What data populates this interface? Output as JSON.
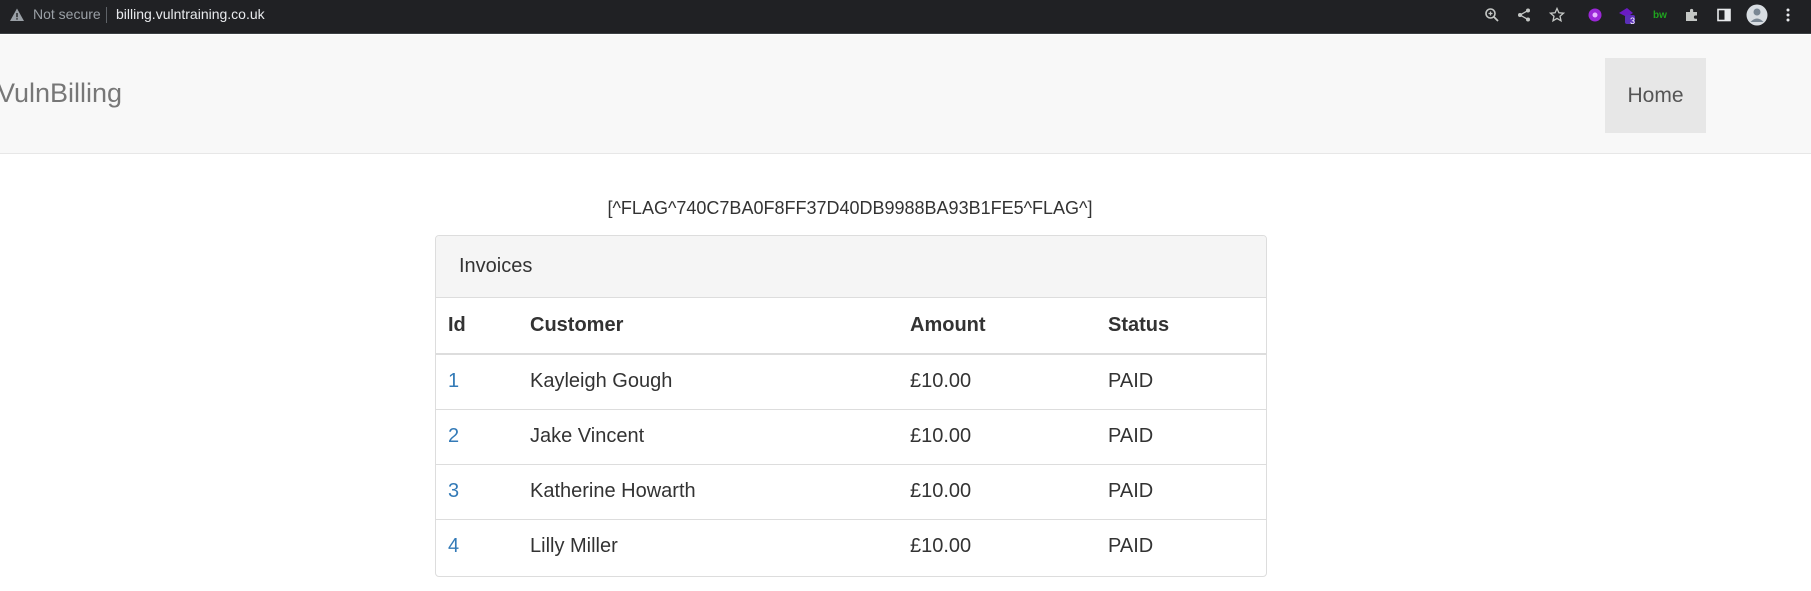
{
  "browser": {
    "security_label": "Not secure",
    "url": "billing.vulntraining.co.uk",
    "extension_badge": "3",
    "bw_label": "bw"
  },
  "navbar": {
    "brand": "VulnBilling",
    "home_link": "Home"
  },
  "flag_text": "[^FLAG^740C7BA0F8FF37D40DB9988BA93B1FE5^FLAG^]",
  "invoices": {
    "title": "Invoices",
    "columns": [
      "Id",
      "Customer",
      "Amount",
      "Status"
    ],
    "rows": [
      {
        "id": "1",
        "customer": "Kayleigh Gough",
        "amount": "£10.00",
        "status": "PAID"
      },
      {
        "id": "2",
        "customer": "Jake Vincent",
        "amount": "£10.00",
        "status": "PAID"
      },
      {
        "id": "3",
        "customer": "Katherine Howarth",
        "amount": "£10.00",
        "status": "PAID"
      },
      {
        "id": "4",
        "customer": "Lilly Miller",
        "amount": "£10.00",
        "status": "PAID"
      }
    ]
  },
  "colors": {
    "link": "#337ab7",
    "navbar_bg": "#f8f8f8",
    "chrome_bg": "#202124"
  }
}
